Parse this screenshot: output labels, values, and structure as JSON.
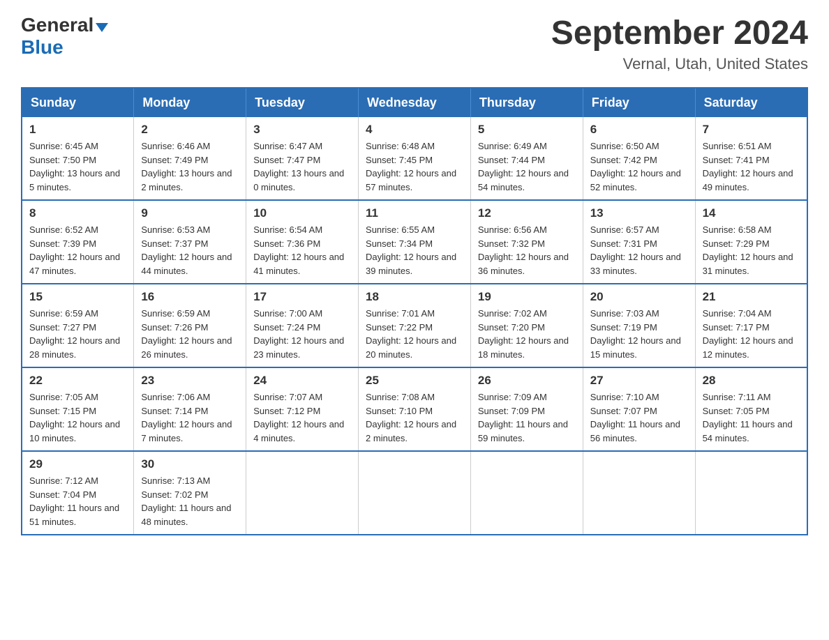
{
  "header": {
    "logo_general": "General",
    "logo_blue": "Blue",
    "main_title": "September 2024",
    "subtitle": "Vernal, Utah, United States"
  },
  "days_of_week": [
    "Sunday",
    "Monday",
    "Tuesday",
    "Wednesday",
    "Thursday",
    "Friday",
    "Saturday"
  ],
  "weeks": [
    [
      {
        "date": "1",
        "sunrise": "6:45 AM",
        "sunset": "7:50 PM",
        "daylight": "13 hours and 5 minutes."
      },
      {
        "date": "2",
        "sunrise": "6:46 AM",
        "sunset": "7:49 PM",
        "daylight": "13 hours and 2 minutes."
      },
      {
        "date": "3",
        "sunrise": "6:47 AM",
        "sunset": "7:47 PM",
        "daylight": "13 hours and 0 minutes."
      },
      {
        "date": "4",
        "sunrise": "6:48 AM",
        "sunset": "7:45 PM",
        "daylight": "12 hours and 57 minutes."
      },
      {
        "date": "5",
        "sunrise": "6:49 AM",
        "sunset": "7:44 PM",
        "daylight": "12 hours and 54 minutes."
      },
      {
        "date": "6",
        "sunrise": "6:50 AM",
        "sunset": "7:42 PM",
        "daylight": "12 hours and 52 minutes."
      },
      {
        "date": "7",
        "sunrise": "6:51 AM",
        "sunset": "7:41 PM",
        "daylight": "12 hours and 49 minutes."
      }
    ],
    [
      {
        "date": "8",
        "sunrise": "6:52 AM",
        "sunset": "7:39 PM",
        "daylight": "12 hours and 47 minutes."
      },
      {
        "date": "9",
        "sunrise": "6:53 AM",
        "sunset": "7:37 PM",
        "daylight": "12 hours and 44 minutes."
      },
      {
        "date": "10",
        "sunrise": "6:54 AM",
        "sunset": "7:36 PM",
        "daylight": "12 hours and 41 minutes."
      },
      {
        "date": "11",
        "sunrise": "6:55 AM",
        "sunset": "7:34 PM",
        "daylight": "12 hours and 39 minutes."
      },
      {
        "date": "12",
        "sunrise": "6:56 AM",
        "sunset": "7:32 PM",
        "daylight": "12 hours and 36 minutes."
      },
      {
        "date": "13",
        "sunrise": "6:57 AM",
        "sunset": "7:31 PM",
        "daylight": "12 hours and 33 minutes."
      },
      {
        "date": "14",
        "sunrise": "6:58 AM",
        "sunset": "7:29 PM",
        "daylight": "12 hours and 31 minutes."
      }
    ],
    [
      {
        "date": "15",
        "sunrise": "6:59 AM",
        "sunset": "7:27 PM",
        "daylight": "12 hours and 28 minutes."
      },
      {
        "date": "16",
        "sunrise": "6:59 AM",
        "sunset": "7:26 PM",
        "daylight": "12 hours and 26 minutes."
      },
      {
        "date": "17",
        "sunrise": "7:00 AM",
        "sunset": "7:24 PM",
        "daylight": "12 hours and 23 minutes."
      },
      {
        "date": "18",
        "sunrise": "7:01 AM",
        "sunset": "7:22 PM",
        "daylight": "12 hours and 20 minutes."
      },
      {
        "date": "19",
        "sunrise": "7:02 AM",
        "sunset": "7:20 PM",
        "daylight": "12 hours and 18 minutes."
      },
      {
        "date": "20",
        "sunrise": "7:03 AM",
        "sunset": "7:19 PM",
        "daylight": "12 hours and 15 minutes."
      },
      {
        "date": "21",
        "sunrise": "7:04 AM",
        "sunset": "7:17 PM",
        "daylight": "12 hours and 12 minutes."
      }
    ],
    [
      {
        "date": "22",
        "sunrise": "7:05 AM",
        "sunset": "7:15 PM",
        "daylight": "12 hours and 10 minutes."
      },
      {
        "date": "23",
        "sunrise": "7:06 AM",
        "sunset": "7:14 PM",
        "daylight": "12 hours and 7 minutes."
      },
      {
        "date": "24",
        "sunrise": "7:07 AM",
        "sunset": "7:12 PM",
        "daylight": "12 hours and 4 minutes."
      },
      {
        "date": "25",
        "sunrise": "7:08 AM",
        "sunset": "7:10 PM",
        "daylight": "12 hours and 2 minutes."
      },
      {
        "date": "26",
        "sunrise": "7:09 AM",
        "sunset": "7:09 PM",
        "daylight": "11 hours and 59 minutes."
      },
      {
        "date": "27",
        "sunrise": "7:10 AM",
        "sunset": "7:07 PM",
        "daylight": "11 hours and 56 minutes."
      },
      {
        "date": "28",
        "sunrise": "7:11 AM",
        "sunset": "7:05 PM",
        "daylight": "11 hours and 54 minutes."
      }
    ],
    [
      {
        "date": "29",
        "sunrise": "7:12 AM",
        "sunset": "7:04 PM",
        "daylight": "11 hours and 51 minutes."
      },
      {
        "date": "30",
        "sunrise": "7:13 AM",
        "sunset": "7:02 PM",
        "daylight": "11 hours and 48 minutes."
      },
      null,
      null,
      null,
      null,
      null
    ]
  ]
}
